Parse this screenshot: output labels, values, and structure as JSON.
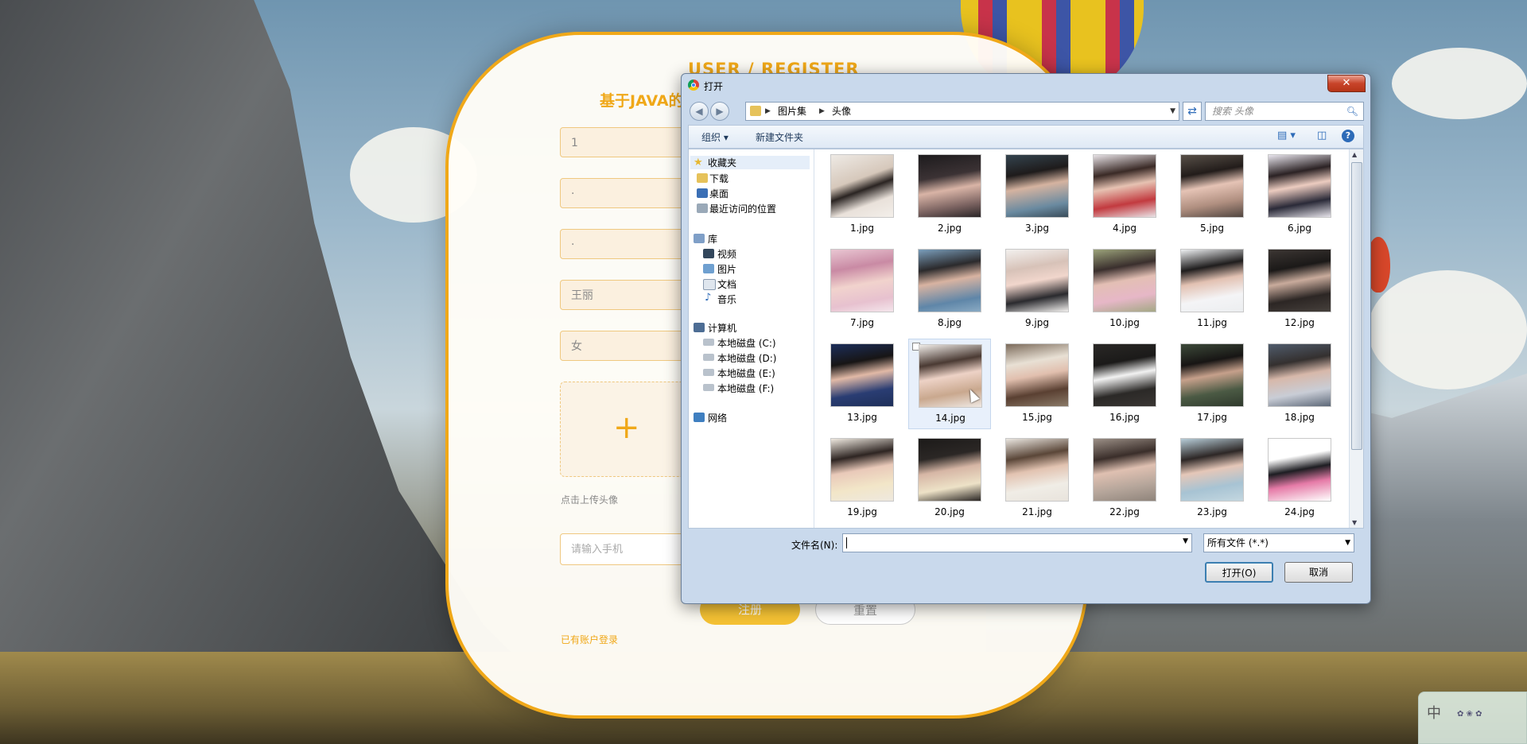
{
  "card": {
    "heading": "USER / REGISTER",
    "subtitle": "基于JAVA的",
    "fields": [
      "1",
      "·",
      "·",
      "王丽",
      "女"
    ],
    "upload_plus": "+",
    "upload_hint": "点击上传头像",
    "phone_placeholder": "请输入手机",
    "register_label": "注册",
    "reset_label": "重置",
    "login_link": "已有账户登录",
    "accent_color": "#f0a818"
  },
  "dialog": {
    "title": "打开",
    "close_label": "✕",
    "breadcrumb": [
      "图片集",
      "头像"
    ],
    "search_placeholder": "搜索 头像",
    "toolbar": {
      "organize": "组织 ▾",
      "new_folder": "新建文件夹",
      "view_icon": "view-menu-icon",
      "help": "?"
    },
    "nav": {
      "favorites": "收藏夹",
      "favorites_items": [
        "下载",
        "桌面",
        "最近访问的位置"
      ],
      "libraries": "库",
      "library_items": [
        "视频",
        "图片",
        "文档",
        "音乐"
      ],
      "computer": "计算机",
      "computer_items": [
        "本地磁盘 (C:)",
        "本地磁盘 (D:)",
        "本地磁盘 (E:)",
        "本地磁盘 (F:)"
      ],
      "network": "网络"
    },
    "files": [
      "1.jpg",
      "2.jpg",
      "3.jpg",
      "4.jpg",
      "5.jpg",
      "6.jpg",
      "7.jpg",
      "8.jpg",
      "9.jpg",
      "10.jpg",
      "11.jpg",
      "12.jpg",
      "13.jpg",
      "14.jpg",
      "15.jpg",
      "16.jpg",
      "17.jpg",
      "18.jpg",
      "19.jpg",
      "20.jpg",
      "21.jpg",
      "22.jpg",
      "23.jpg",
      "24.jpg"
    ],
    "hovered_file": "14.jpg",
    "filename_label": "文件名(N):",
    "filename_value": "",
    "filetype_value": "所有文件 (*.*)",
    "open_label": "打开(O)",
    "cancel_label": "取消"
  },
  "ime": {
    "mode": "中"
  }
}
